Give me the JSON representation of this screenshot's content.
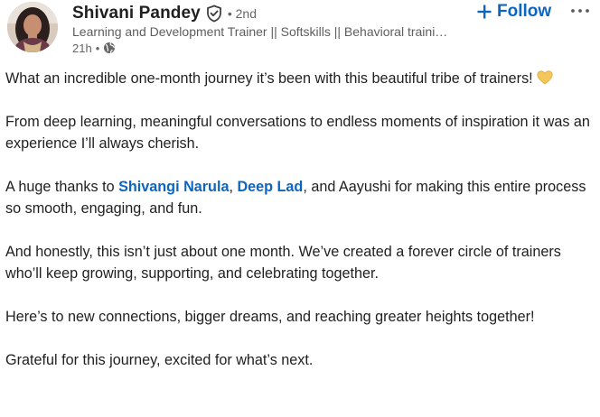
{
  "author": {
    "name": "Shivani Pandey",
    "degree": "• 2nd",
    "headline": "Learning and Development Trainer || Softskills || Behavioral traini…",
    "time": "21h",
    "time_separator": "•",
    "verified_icon": "verified-shield-icon",
    "visibility_icon": "globe-icon"
  },
  "actions": {
    "follow_label": "Follow",
    "follow_icon": "plus-icon",
    "more_label": "···",
    "accent_color": "#0a66c2"
  },
  "post": {
    "p1": "What an incredible one-month journey it’s been with this beautiful tribe of trainers!",
    "p1_emoji": "yellow-heart-icon",
    "p2": "From deep learning, meaningful conversations to endless moments of inspiration it was an experience I’ll always cherish.",
    "p3_before": "A huge thanks to ",
    "mention_1": "Shivangi Narula",
    "p3_sep": ", ",
    "mention_2": "Deep Lad",
    "p3_after": ", and Aayushi for making this entire process so smooth, engaging, and fun.",
    "p4": "And honestly, this isn’t just about one month. We’ve created a forever circle of trainers who’ll keep growing, supporting, and celebrating together.",
    "p5": "Here’s to new connections, bigger dreams, and reaching greater heights together!",
    "p6": "Grateful for this journey, excited for what’s next."
  }
}
